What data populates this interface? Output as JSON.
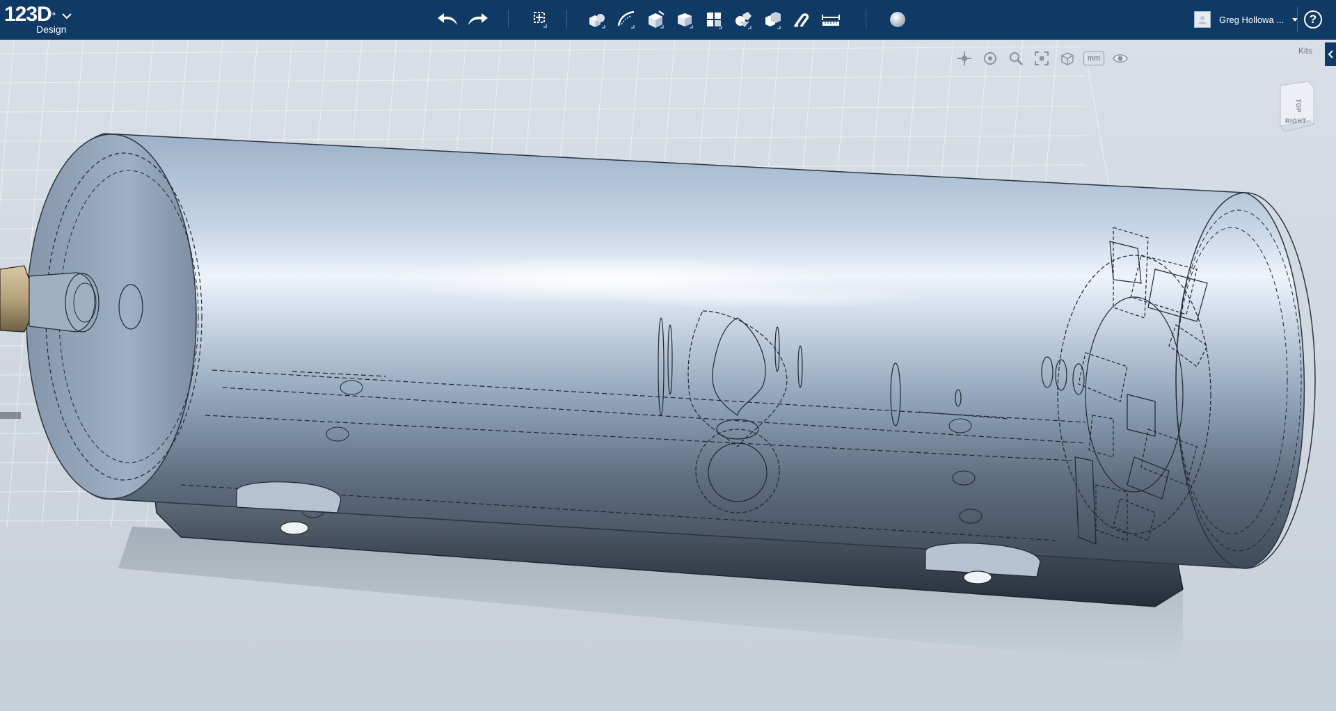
{
  "app": {
    "logo_text": "123D",
    "logo_superscript": "°",
    "logo_subtitle": "Design"
  },
  "toolbar": {
    "icons": [
      "undo-icon",
      "redo-icon",
      "transform-icon",
      "primitives-icon",
      "sketch-icon",
      "construct-icon",
      "modify-icon",
      "pattern-icon",
      "grouping-icon",
      "combine-icon",
      "snap-icon",
      "measure-icon",
      "material-icon"
    ]
  },
  "user": {
    "name": "Greg Hollowa ..."
  },
  "help": {
    "label": "?"
  },
  "navbar": {
    "units_label": "mm"
  },
  "kits": {
    "label": "Kits"
  },
  "viewcube": {
    "top_label": "TOP",
    "right_label": "RIGHT"
  },
  "colors": {
    "topbar": "#0f3a66",
    "viewport_bg": "#cfd6de",
    "grid_line": "#ffffff",
    "model_body": "#8fa3bb",
    "model_highlight": "#e9f1fa",
    "model_shadow": "#2a3340"
  }
}
